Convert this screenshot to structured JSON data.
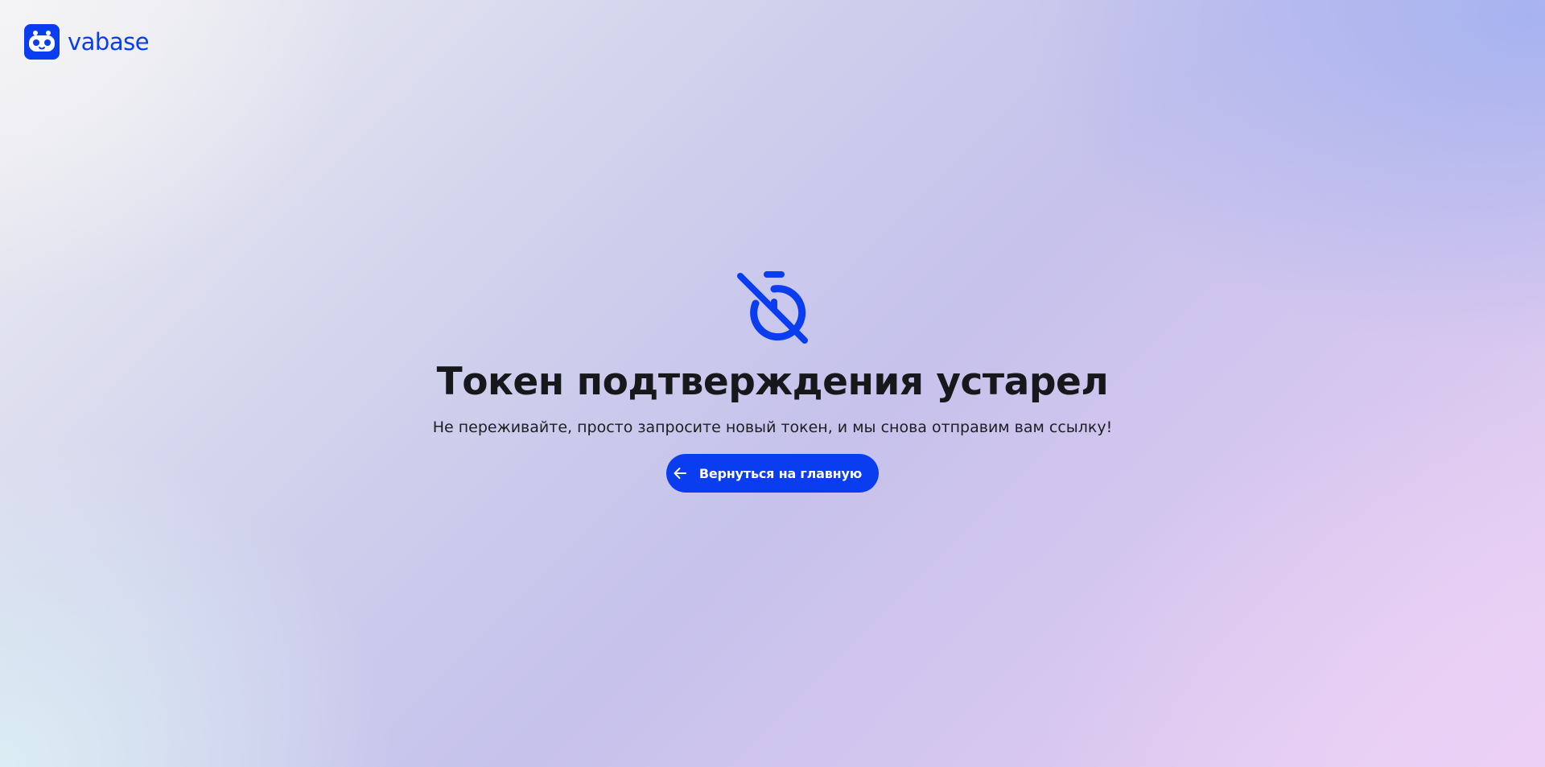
{
  "brand": {
    "name": "vabase",
    "logo_icon": "robot-face-icon",
    "color": "#0a3cf0"
  },
  "main": {
    "icon": "timer-off-icon",
    "title": "Токен подтверждения устарел",
    "subtitle": "Не переживайте, просто запросите новый токен, и мы снова отправим вам ссылку!",
    "back_button": {
      "label": "Вернуться на главную",
      "icon": "arrow-left-icon"
    }
  },
  "colors": {
    "accent": "#0a3cf0",
    "text": "#17181c"
  }
}
